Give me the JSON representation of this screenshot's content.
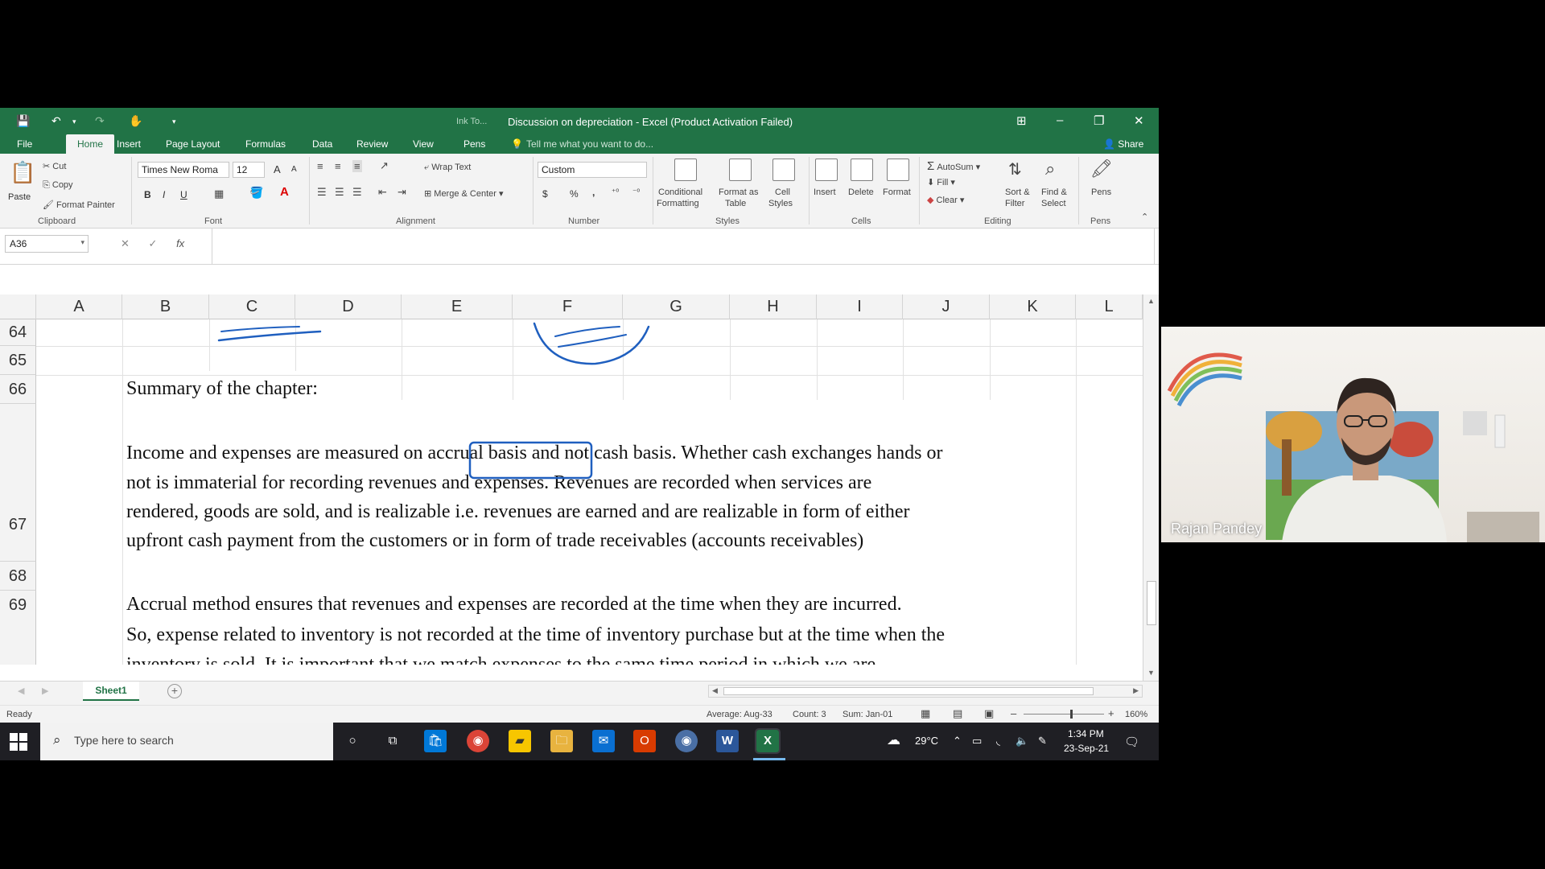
{
  "window": {
    "title": "Discussion on depreciation - Excel (Product Activation Failed)",
    "ink_label": "Ink To...",
    "controls": [
      "⊞",
      "–",
      "❐",
      "✕"
    ]
  },
  "tabs": {
    "items": [
      "File",
      "Home",
      "Insert",
      "Page Layout",
      "Formulas",
      "Data",
      "Review",
      "View",
      "Pens"
    ],
    "active": "Home",
    "tell_me": "Tell me what you want to do...",
    "share": "Share"
  },
  "ribbon": {
    "clipboard": {
      "paste": "Paste",
      "cut": "Cut",
      "copy": "Copy",
      "format_painter": "Format Painter",
      "label": "Clipboard"
    },
    "font": {
      "name": "Times New Roma",
      "size": "12",
      "bold": "B",
      "italic": "I",
      "underline": "U",
      "grow": "A",
      "shrink": "A",
      "label": "Font"
    },
    "alignment": {
      "wrap_text": "Wrap Text",
      "merge_center": "Merge & Center",
      "label": "Alignment"
    },
    "number": {
      "format": "Custom",
      "currency": "$",
      "percent": "%",
      "comma": ",",
      "label": "Number"
    },
    "styles": {
      "conditional": [
        "Conditional",
        "Formatting"
      ],
      "format_as_table": [
        "Format as",
        "Table"
      ],
      "cell_styles": [
        "Cell",
        "Styles"
      ],
      "label": "Styles"
    },
    "cells": {
      "insert": "Insert",
      "delete": "Delete",
      "format": "Format",
      "label": "Cells"
    },
    "editing": {
      "autosum": "AutoSum",
      "fill": "Fill",
      "clear": "Clear",
      "sort_filter": [
        "Sort &",
        "Filter"
      ],
      "find_select": [
        "Find &",
        "Select"
      ],
      "label": "Editing"
    },
    "pens": {
      "pens": "Pens",
      "label": "Pens"
    }
  },
  "formula_bar": {
    "name_box": "A36",
    "fx": "fx",
    "formula": ""
  },
  "sheet": {
    "columns": [
      "A",
      "B",
      "C",
      "D",
      "E",
      "F",
      "G",
      "H",
      "I",
      "J",
      "K",
      "L"
    ],
    "rows": [
      "64",
      "65",
      "66",
      "67",
      "68",
      "69"
    ],
    "summary_heading": "Summary of the chapter:",
    "row67_lines": [
      "Income and expenses are measured on accrual basis and not cash basis. Whether cash exchanges hands or",
      "not is immaterial for recording revenues and expenses. Revenues are recorded when services are",
      "rendered, goods are sold, and is realizable i.e. revenues are earned and are realizable in form of either",
      "upfront cash payment from the customers or in form of trade receivables (accounts receivables)"
    ],
    "row69_lines": [
      "Accrual method ensures that revenues and expenses are recorded at the time when they are incurred.",
      "So, expense related to inventory is not recorded at the time of inventory purchase but at the time when the",
      "inventory is sold. It is important that we match expenses to the same time period in which we are"
    ],
    "highlight_phrase": "accrual basis",
    "ink_color": "#1f5fbf"
  },
  "sheet_tabs": {
    "active": "Sheet1",
    "add": "+"
  },
  "status": {
    "ready": "Ready",
    "average": "Average: Aug-33",
    "count": "Count: 3",
    "sum": "Sum: Jan-01",
    "zoom": "160%"
  },
  "taskbar": {
    "search_placeholder": "Type here to search",
    "weather": "29°C",
    "time": "1:34 PM",
    "date": "23-Sep-21"
  },
  "webcam": {
    "name": "Rajan Pandey"
  },
  "colors": {
    "excel_green": "#217346",
    "taskbar": "#1f1f24"
  }
}
